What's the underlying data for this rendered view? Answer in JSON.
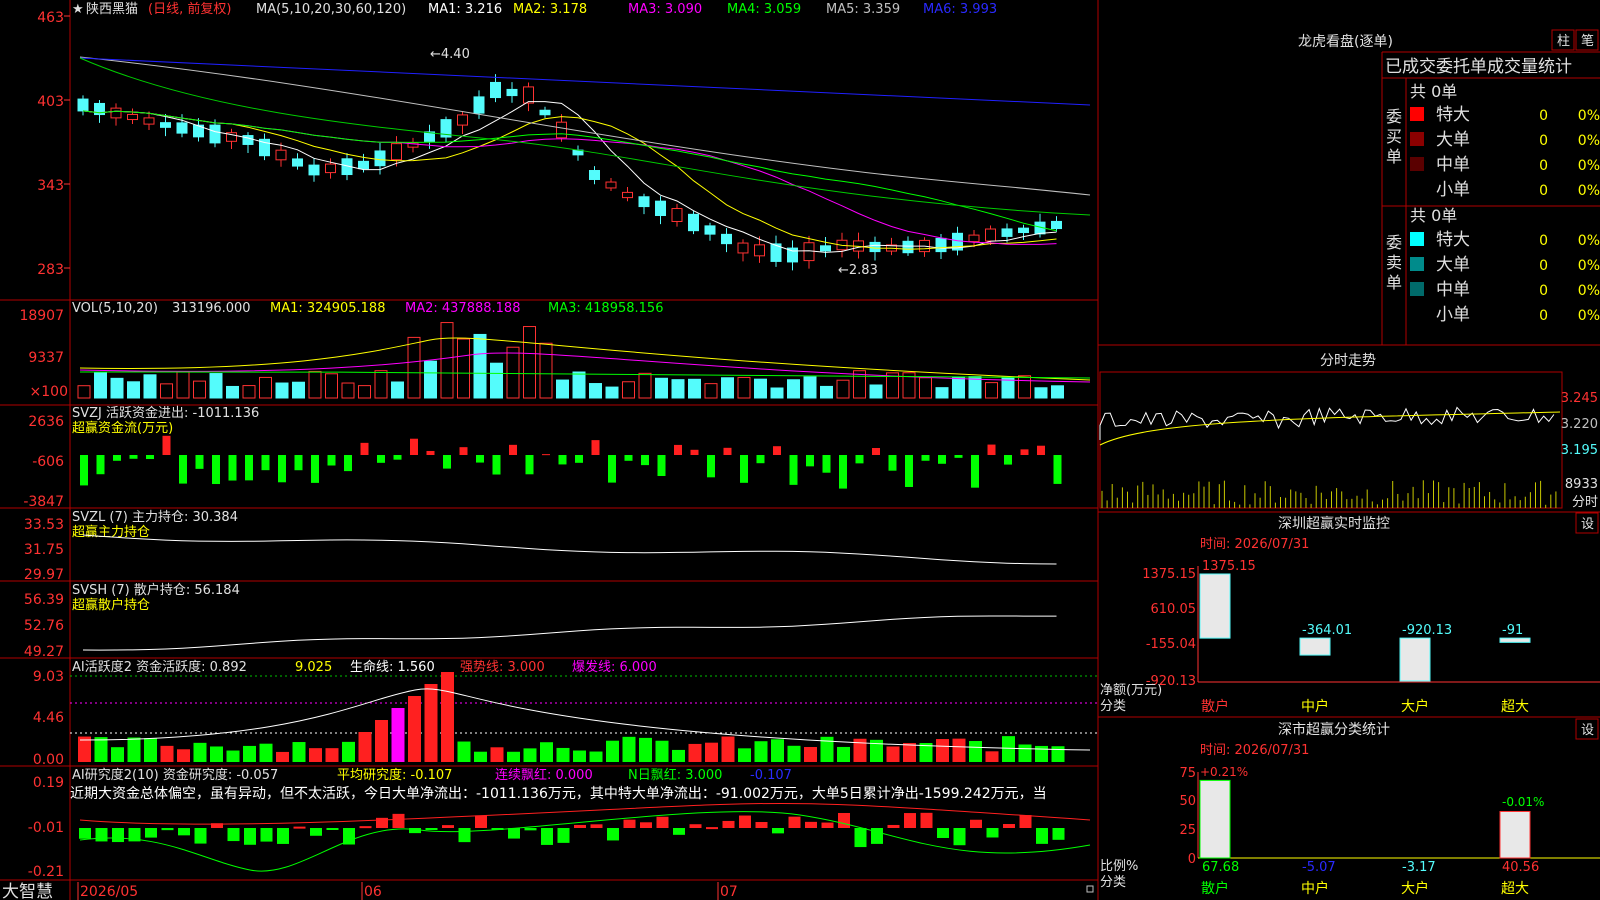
{
  "stock": {
    "star": "★",
    "name": "陕西黑猫",
    "period": "(日线, 前复权)",
    "ma_label": "MA(5,10,20,30,60,120)",
    "ma1": "MA1: 3.216",
    "ma2": "MA2: 3.178",
    "ma3": "MA3: 3.090",
    "ma4": "MA4: 3.059",
    "ma5": "MA5: 3.359",
    "ma6": "MA6: 3.993",
    "peak_label": "4.40",
    "trough_label": "2.83",
    "price_axis": [
      "463",
      "403",
      "343",
      "283"
    ]
  },
  "vol": {
    "label": "VOL(5,10,20)",
    "value": "313196.000",
    "ma1": "MA1: 324905.188",
    "ma2": "MA2: 437888.188",
    "ma3": "MA3: 418958.156",
    "axis": [
      "18907",
      "9337",
      "×100"
    ]
  },
  "svzj": {
    "label": "SVZJ  活跃资金进出: -1011.136",
    "sub": "超赢资金流(万元)",
    "axis": [
      "2636",
      "-606",
      "-3847"
    ]
  },
  "svzl": {
    "label": "SVZL (7) 主力持仓: 30.384",
    "sub": "超赢主力持仓",
    "axis": [
      "33.53",
      "31.75",
      "29.97"
    ]
  },
  "svsh": {
    "label": "SVSH (7) 散户持仓: 56.184",
    "sub": "超赢散户持仓",
    "axis": [
      "56.39",
      "52.76",
      "49.27"
    ]
  },
  "ai1": {
    "label": "AI活跃度2 资金活跃度: 0.892",
    "v2": "9.025",
    "v3": "生命线: 1.560",
    "v4": "强势线: 3.000",
    "v5": "爆发线: 6.000",
    "axis": [
      "9.03",
      "4.46",
      "0.00"
    ]
  },
  "ai2": {
    "label": "AI研究度2(10) 资金研究度: -0.057",
    "v2": "平均研究度: -0.107",
    "v3": "连续飘红: 0.000",
    "v4": "N日飘红: 3.000",
    "v5": "-0.107",
    "comment": "近期大资金总体偏空，虽有异动，但不太活跃，今日大单净流出：-1011.136万元，其中特大单净流出：-91.002万元，大单5日累计净出-1599.242万元，当",
    "axis": [
      "0.19",
      "-0.01",
      "-0.21"
    ]
  },
  "xaxis": {
    "brand": "大智慧",
    "d1": "2026/05",
    "d2": "06",
    "d3": "07"
  },
  "right": {
    "dragon_title": "龙虎看盘(逐单)",
    "btn1": "柱",
    "btn2": "笔",
    "order_title": "已成交委托单成交量统计",
    "buy_side": "委买单",
    "sell_side": "委卖单",
    "buy_total": "共 0单",
    "sell_total": "共 0单",
    "buy_rows": [
      {
        "label": "特大",
        "v": "0",
        "p": "0%",
        "color": "#ff0000"
      },
      {
        "label": "大单",
        "v": "0",
        "p": "0%",
        "color": "#8b0000"
      },
      {
        "label": "中单",
        "v": "0",
        "p": "0%",
        "color": "#5a0000"
      },
      {
        "label": "小单",
        "v": "0",
        "p": "0%",
        "color": "#000000"
      }
    ],
    "sell_rows": [
      {
        "label": "特大",
        "v": "0",
        "p": "0%",
        "color": "#00ffff"
      },
      {
        "label": "大单",
        "v": "0",
        "p": "0%",
        "color": "#008b8b"
      },
      {
        "label": "中单",
        "v": "0",
        "p": "0%",
        "color": "#006a6a"
      },
      {
        "label": "小单",
        "v": "0",
        "p": "0%",
        "color": "#000000"
      }
    ],
    "fenshi_title": "分时走势",
    "fenshi_axis": [
      "3.245",
      "3.220",
      "3.195"
    ],
    "fenshi_vol": "8933",
    "fenshi_unit": "分时",
    "sz_title": "深圳超赢实时监控",
    "sz_btn": "设",
    "sz_time": "时间: 2026/07/31",
    "sz_axis": [
      "1375.15",
      "610.05",
      "-155.04",
      "-920.13"
    ],
    "sz_ylabel": "净额(万元)",
    "sz_xlabel": "分类",
    "sz_cats": [
      "散户",
      "中户",
      "大户",
      "超大"
    ],
    "sz_values": [
      1375.15,
      -364.01,
      -920.13,
      -91
    ],
    "sz_value_labels": [
      "1375.15",
      "-364.01",
      "-920.13",
      "-91"
    ],
    "ss_title": "深市超赢分类统计",
    "ss_btn": "设",
    "ss_time": "时间: 2026/07/31",
    "ss_axis": [
      "75",
      "50",
      "25",
      "0"
    ],
    "ss_top_label": "+0.21%",
    "ss_small_label": "-0.01%",
    "ss_ylabel": "比例%",
    "ss_xlabel": "分类",
    "ss_cats": [
      "散户",
      "中户",
      "大户",
      "超大"
    ],
    "ss_values": [
      67.68,
      -5.07,
      -3.17,
      40.56
    ],
    "ss_value_labels": [
      "67.68",
      "-5.07",
      "-3.17",
      "40.56"
    ]
  },
  "colors": {
    "up": "#ff3232",
    "down": "#54fcfc",
    "grid": "#b00000",
    "ma1": "#ffffff",
    "ma2": "#ffff00",
    "ma3": "#ff00ff",
    "ma4": "#00ff00",
    "ma5": "#c0c0c0",
    "ma6": "#2020ff"
  }
}
